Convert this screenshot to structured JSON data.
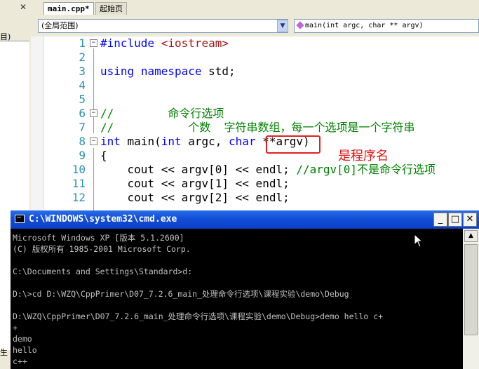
{
  "left_pane": {
    "close_glyph": "✕",
    "label": "目)",
    "bottom_label": "生"
  },
  "tabs": [
    {
      "label": "main.cpp*"
    },
    {
      "label": "起始页"
    }
  ],
  "nav": {
    "scope": "(全局范围)",
    "function": "main(int argc, char ** argv)"
  },
  "editor": {
    "lines": [
      {
        "n": "1",
        "text": "#include <iostream>"
      },
      {
        "n": "2",
        "text": ""
      },
      {
        "n": "3",
        "text": "using namespace std;"
      },
      {
        "n": "4",
        "text": ""
      },
      {
        "n": "5",
        "text": ""
      },
      {
        "n": "6",
        "text": "//        命令行选项"
      },
      {
        "n": "7",
        "text": "//           个数  字符串数组，每一个选项是一个字符串"
      },
      {
        "n": "8",
        "text": "int main(int argc, char **argv)"
      },
      {
        "n": "9",
        "text": "{"
      },
      {
        "n": "10",
        "text": "    cout << argv[0] << endl; //argv[0]不是命令行选项"
      },
      {
        "n": "11",
        "text": "    cout << argv[1] << endl;"
      },
      {
        "n": "12",
        "text": "    cout << argv[2] << endl;"
      }
    ],
    "annotation": "是程序名"
  },
  "console": {
    "title": "C:\\WINDOWS\\system32\\cmd.exe",
    "buttons": {
      "minimize": "_",
      "maximize": "□",
      "close": "✕"
    },
    "lines": [
      "Microsoft Windows XP [版本 5.1.2600]",
      "(C) 版权所有 1985-2001 Microsoft Corp.",
      "",
      "C:\\Documents and Settings\\Standard>d:",
      "",
      "D:\\>cd D:\\WZQ\\CppPrimer\\D07_7.2.6_main_处理命令行选项\\课程实验\\demo\\Debug",
      "",
      "D:\\WZQ\\CppPrimer\\D07_7.2.6_main_处理命令行选项\\课程实验\\demo\\Debug>demo hello c+",
      "+",
      "demo",
      "hello",
      "c++"
    ]
  },
  "colors": {
    "keyword": "#0000ff",
    "comment": "#008000",
    "string": "#a31515",
    "line_number": "#2b91af",
    "highlight": "#e02020",
    "console_bg": "#000000",
    "console_text": "#c0c0c0"
  }
}
